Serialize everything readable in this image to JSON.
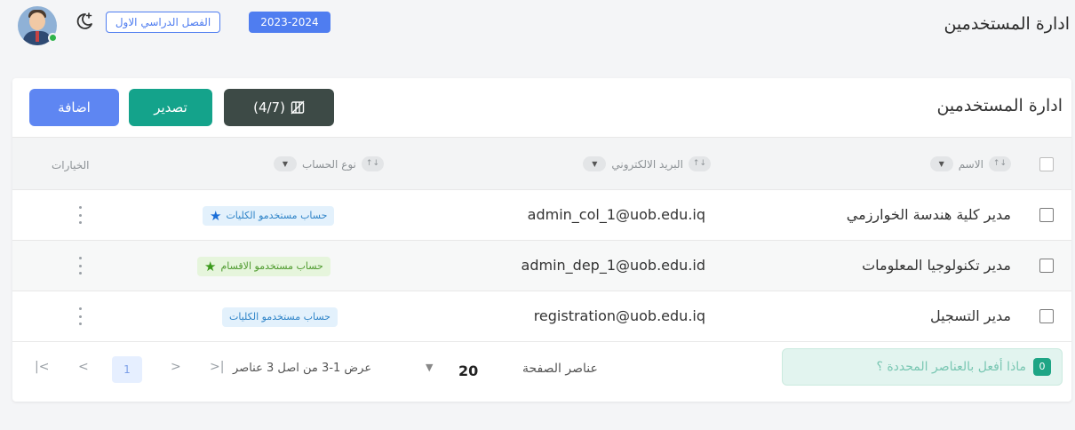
{
  "header": {
    "page_title": "ادارة المستخدمين",
    "academic_year": "2023-2024",
    "semester": "الفصل الدراسي الاول",
    "theme_icon": "moon-star-icon",
    "avatar_icon": "user-avatar"
  },
  "card": {
    "title": "ادارة المستخدمين",
    "buttons": {
      "add": "اضافة",
      "export": "تصدير",
      "columns": "(4/7)"
    }
  },
  "table": {
    "sort_chip": "↓↑",
    "columns": {
      "name": "الاسم",
      "email": "البريد الالكتروني",
      "account_type": "نوع الحساب",
      "options": "الخيارات"
    },
    "rows": [
      {
        "name": "مدير كلية هندسة الخوارزمي",
        "email": "admin_col_1@uob.edu.iq",
        "account_type": "حساب مستخدمو الكليات",
        "badge_color": "#e3f1fc",
        "star": true
      },
      {
        "name": "مدير تكنولوجيا المعلومات",
        "email": "admin_dep_1@uob.edu.id",
        "account_type": "حساب مستخدمو الاقسام",
        "badge_color": "#e6f5dc",
        "star": true
      },
      {
        "name": "مدير التسجيل",
        "email": "registration@uob.edu.iq",
        "account_type": "حساب مستخدمو الكليات",
        "badge_color": "#e3f1fc",
        "star": false
      }
    ]
  },
  "footer": {
    "bulk_count": "0",
    "bulk_label": "ماذا أفعل بالعناصر المحددة ؟",
    "per_page_label": "عناصر الصفحة",
    "per_page_value": "20",
    "range_text": "عرض 1-3 من اصل 3 عناصر",
    "current_page": "1",
    "pager": {
      "first": "|<",
      "prev": "<",
      "next": ">",
      "last": ">|"
    }
  },
  "colors": {
    "primary": "#5e86f2",
    "teal": "#14a38b",
    "dark": "#3d4a46",
    "star_blue": "#1a6ed8",
    "star_green": "#3b9a1b"
  }
}
